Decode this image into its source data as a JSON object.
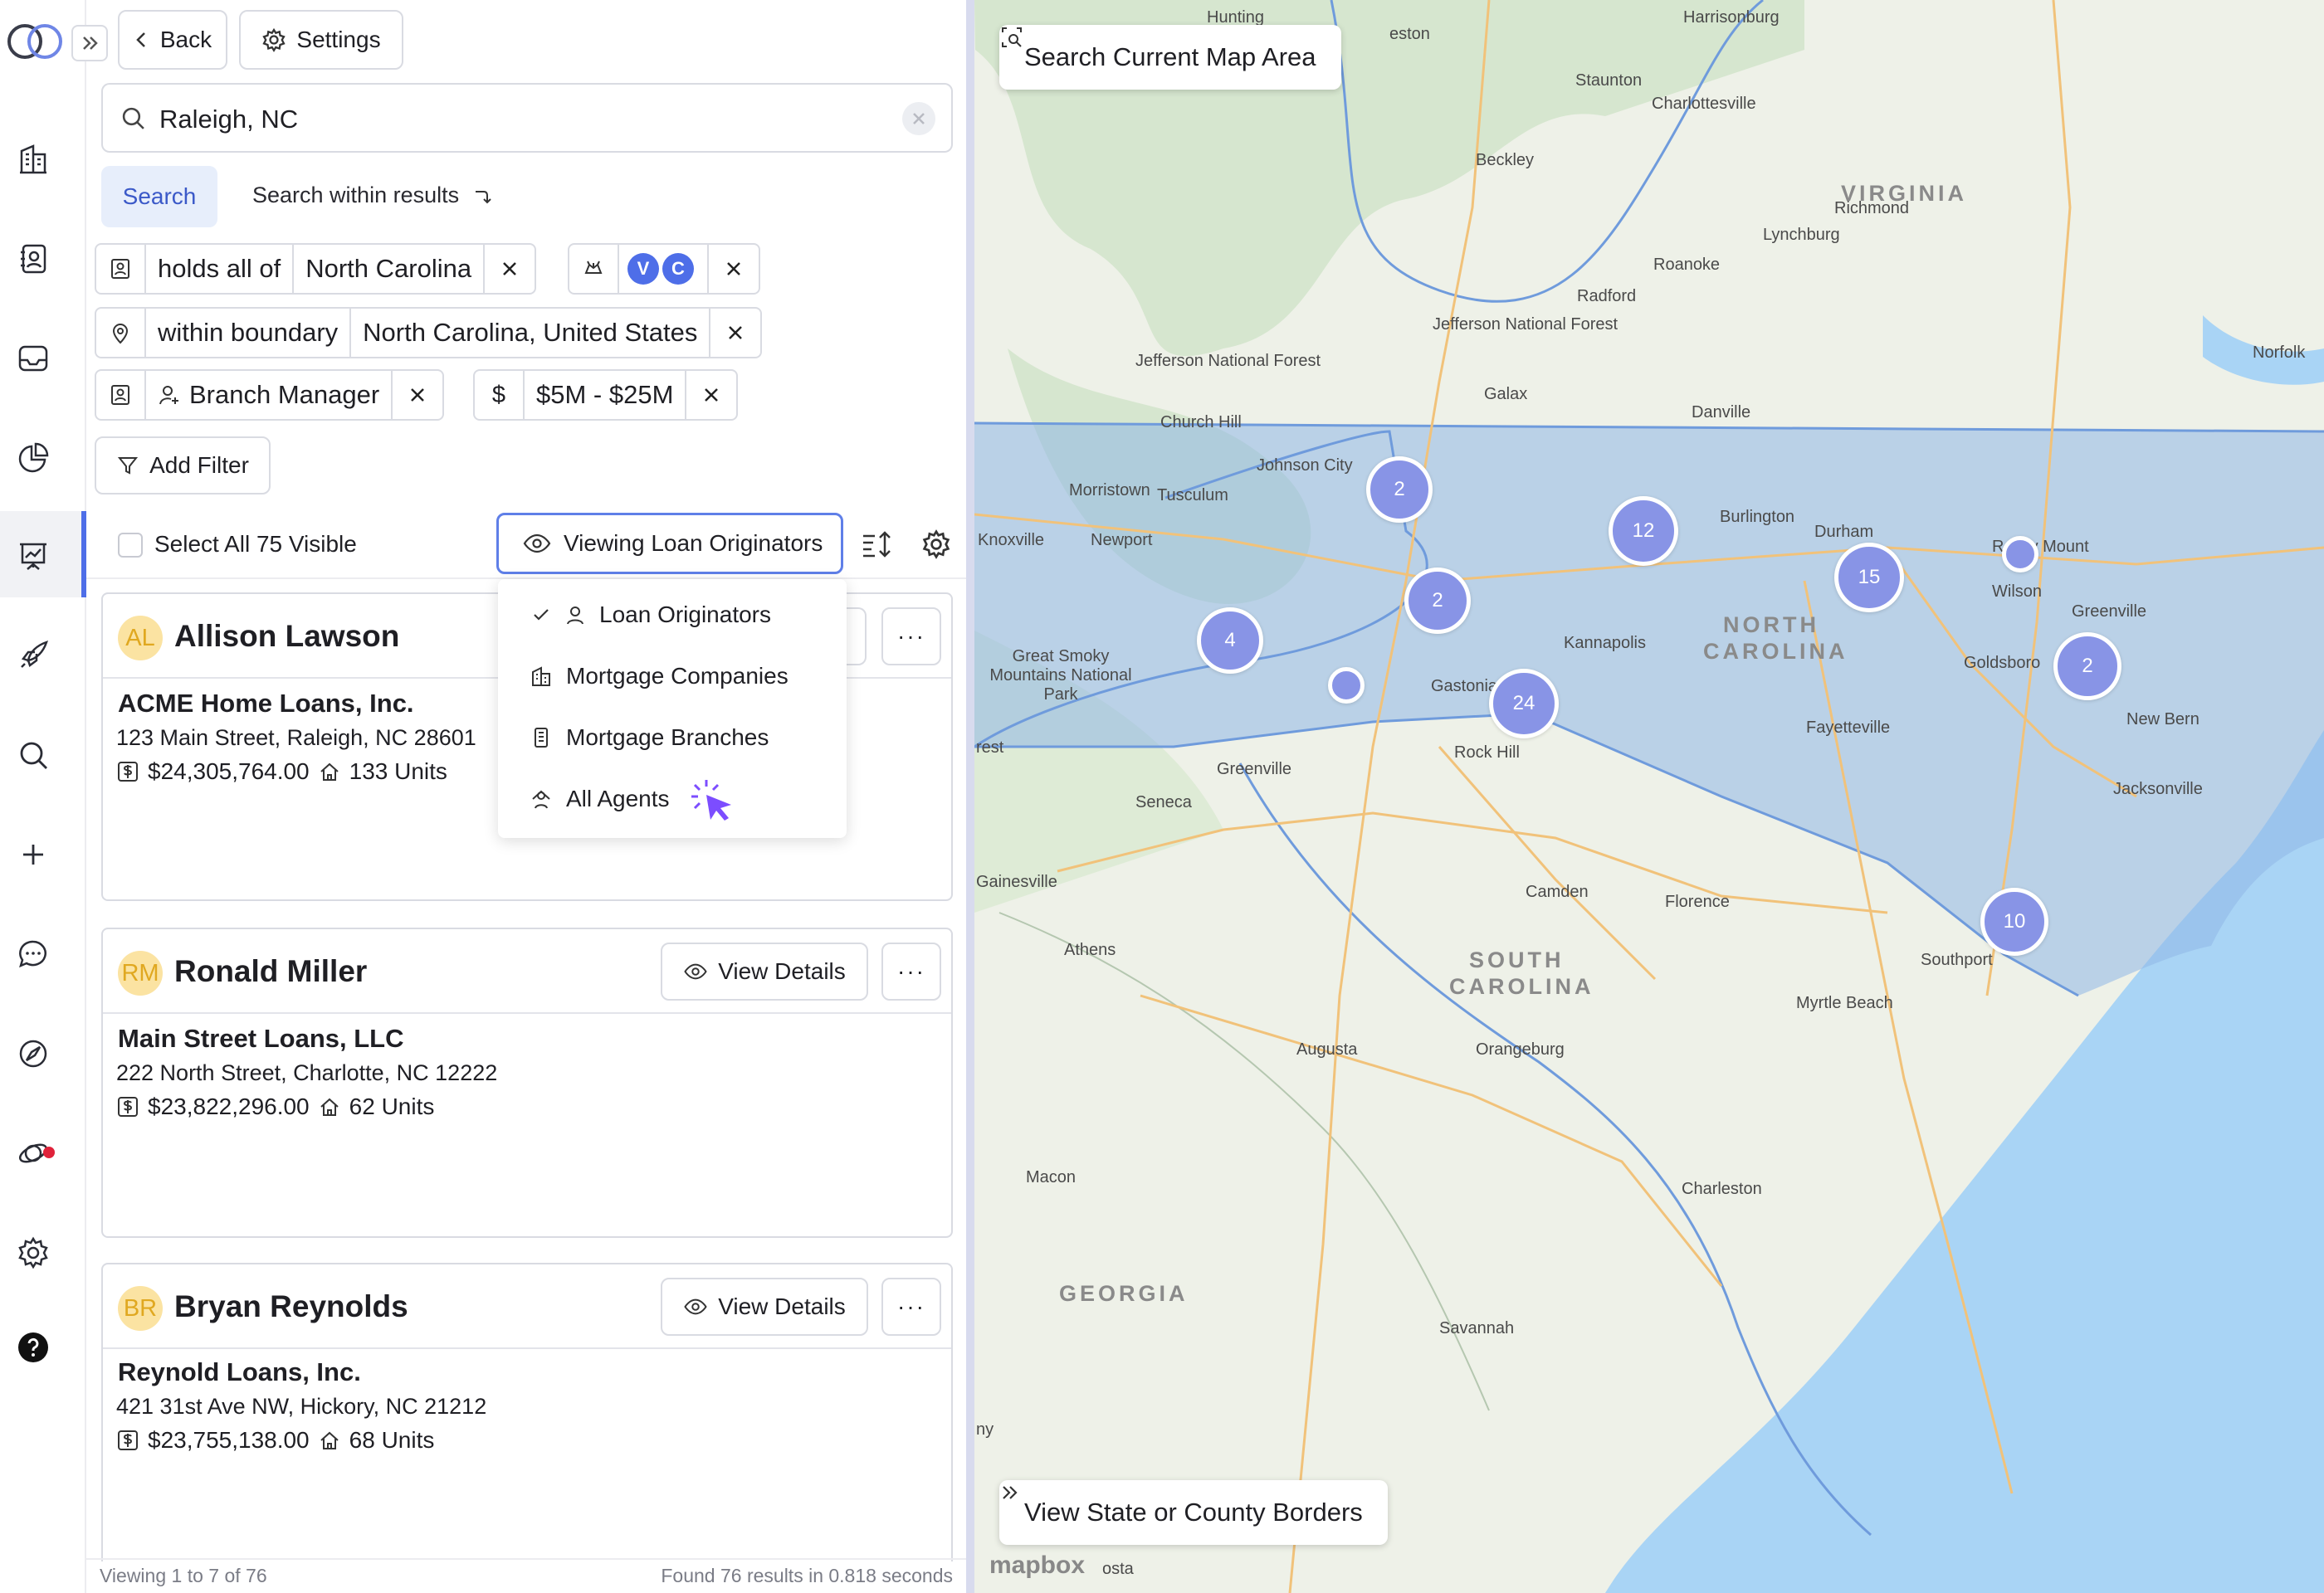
{
  "nav": {
    "back_label": "Back",
    "settings_label": "Settings"
  },
  "search": {
    "value": "Raleigh, NC",
    "button_label": "Search",
    "within_label": "Search within results"
  },
  "filters": {
    "licenses": {
      "op": "holds all of",
      "value": "North Carolina",
      "badges": [
        "V",
        "C"
      ]
    },
    "location": {
      "op": "within boundary",
      "value": "North Carolina, United States"
    },
    "role": {
      "value": "Branch Manager"
    },
    "volume": {
      "symbol": "$",
      "value": "$5M - $25M"
    },
    "add_label": "Add Filter"
  },
  "toolbar": {
    "select_all_label": "Select All 75 Visible",
    "viewing_label": "Viewing Loan Originators"
  },
  "dropdown": {
    "items": [
      "Loan Originators",
      "Mortgage Companies",
      "Mortgage Branches",
      "All Agents"
    ],
    "selected": "Loan Originators"
  },
  "results": [
    {
      "initials": "AL",
      "name": "Allison Lawson",
      "company": "ACME Home Loans, Inc.",
      "address": "123 Main Street, Raleigh, NC 28601",
      "volume": "$24,305,764.00",
      "units": "133 Units"
    },
    {
      "initials": "RM",
      "name": "Ronald Miller",
      "company": "Main Street Loans, LLC",
      "address": "222 North Street, Charlotte, NC 12222",
      "volume": "$23,822,296.00",
      "units": "62 Units",
      "details_label": "View Details"
    },
    {
      "initials": "BR",
      "name": "Bryan Reynolds",
      "company": "Reynold Loans, Inc.",
      "address": "421 31st Ave NW, Hickory, NC 21212",
      "volume": "$23,755,138.00",
      "units": "68 Units",
      "details_label": "View Details"
    }
  ],
  "more_label": "···",
  "footer": {
    "left": "Viewing 1 to 7 of 76",
    "right": "Found 76 results in 0.818 seconds"
  },
  "map": {
    "search_area_label": "Search Current Map Area",
    "borders_label": "View State or County Borders",
    "attribution": "mapbox",
    "clusters": [
      "2",
      "12",
      "15",
      "2",
      "4",
      "24",
      "2",
      "10",
      "",
      ""
    ],
    "states": [
      "VIRGINIA",
      "NORTH",
      "CAROLINA",
      "SOUTH",
      "CAROLINA",
      "GEORGIA"
    ],
    "cities": [
      "Harrisonburg",
      "Staunton",
      "Charlottesville",
      "Beckley",
      "Richmond",
      "Lynchburg",
      "Roanoke",
      "Radford",
      "Jefferson National Forest",
      "Jefferson National Forest",
      "Galax",
      "Danville",
      "Norfolk",
      "Church Hill",
      "Johnson City",
      "Morristown",
      "Tusculum",
      "Knoxville",
      "Newport",
      "Burlington",
      "Durham",
      "Rocky Mount",
      "Wilson",
      "Greenville",
      "Goldsboro",
      "Kannapolis",
      "Gastonia",
      "Rock Hill",
      "Fayetteville",
      "New Bern",
      "Jacksonville",
      "Great Smoky Mountains National Park",
      "Greenville",
      "Seneca",
      "Gainesville",
      "Camden",
      "Florence",
      "Athens",
      "Augusta",
      "Orangeburg",
      "Myrtle Beach",
      "Southport",
      "Macon",
      "Charleston",
      "Savannah",
      "Hunting",
      "eston",
      "rest",
      "ny",
      "osta"
    ]
  },
  "colors": {
    "accent": "#4e6ee8",
    "cluster": "#8894e6",
    "nc_fill": "#8fb7e6",
    "water": "#a9d4f5"
  }
}
